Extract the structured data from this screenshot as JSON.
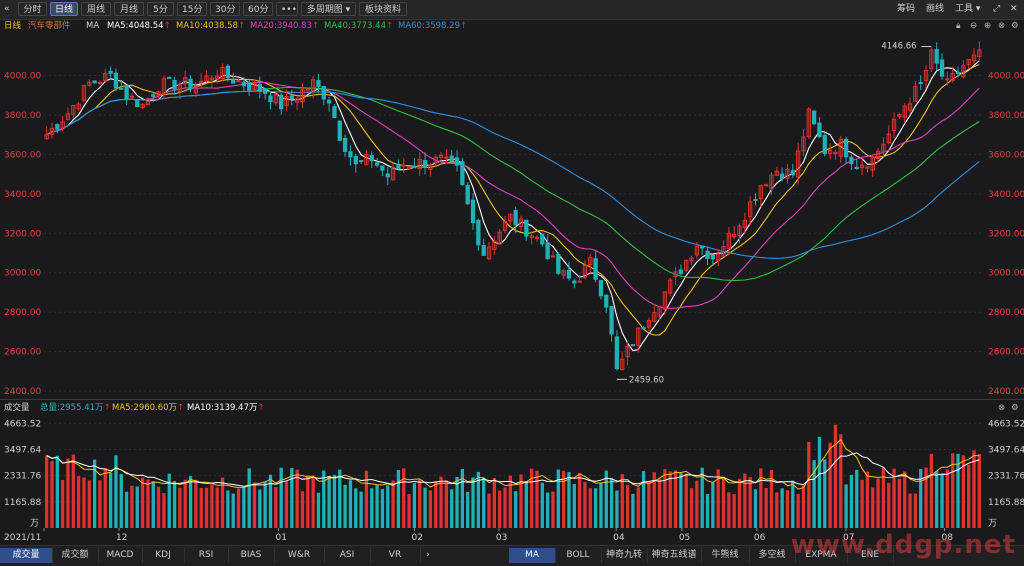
{
  "toolbar": {
    "back_glyph": "«",
    "periods": [
      "分时",
      "日线",
      "周线",
      "月线",
      "5分",
      "15分",
      "30分",
      "60分",
      "•••"
    ],
    "active_period": "日线",
    "multi_period": "多周期图",
    "sector_info": "板块资料",
    "right": [
      "筹码",
      "画线",
      "工具"
    ],
    "icons": [
      "dropdown-icon",
      "expand-icon",
      "close-icon"
    ]
  },
  "legend": {
    "period": "日线",
    "name": "汽车零部件",
    "ma": "MA",
    "items": [
      {
        "label": "MA5:4048.54",
        "color": "#ffffff"
      },
      {
        "label": "MA10:4038.58",
        "color": "#f0c020"
      },
      {
        "label": "MA20:3940.83",
        "color": "#e040c0"
      },
      {
        "label": "MA40:3773.44",
        "color": "#30c040"
      },
      {
        "label": "MA60:3598.29",
        "color": "#3090e0"
      }
    ],
    "arrow": "↑"
  },
  "volume_legend": {
    "title": "成交量",
    "items": [
      {
        "label": "总量:2955.41万",
        "color": "#30b0c0"
      },
      {
        "label": "MA5:2960.60万",
        "color": "#f0c020"
      },
      {
        "label": "MA10:3139.47万",
        "color": "#ffffff"
      }
    ],
    "arrow": "↑"
  },
  "colors": {
    "up": "#e03030",
    "down": "#20b0b8",
    "grid": "#2e2e34",
    "axis_text": "#cfcfcf",
    "price_text_right": "#e04040"
  },
  "chart_data": [
    {
      "type": "candlestick",
      "ylim": [
        2380,
        4180
      ],
      "y_ticks": [
        "4000.00",
        "3800.00",
        "3600.00",
        "3400.00",
        "3200.00",
        "3000.00",
        "2800.00",
        "2600.00",
        "2400.00"
      ],
      "y_tick_values": [
        4000,
        3800,
        3600,
        3400,
        3200,
        3000,
        2800,
        2600,
        2400
      ],
      "x_labels": [
        "2021/11",
        "12",
        "01",
        "02",
        "03",
        "04",
        "05",
        "06",
        "07",
        "08"
      ],
      "annotations": [
        {
          "text": "4146.66",
          "value": 4146.66,
          "index": 166
        },
        {
          "text": "2459.60",
          "value": 2459.6,
          "index": 107
        }
      ],
      "candle_count": 176,
      "anchors": [
        [
          0,
          3700
        ],
        [
          4,
          3810
        ],
        [
          8,
          3960
        ],
        [
          12,
          4000
        ],
        [
          15,
          3900
        ],
        [
          18,
          3850
        ],
        [
          21,
          3950
        ],
        [
          25,
          3960
        ],
        [
          28,
          3950
        ],
        [
          32,
          4020
        ],
        [
          35,
          3980
        ],
        [
          38,
          3950
        ],
        [
          41,
          3920
        ],
        [
          44,
          3850
        ],
        [
          47,
          3900
        ],
        [
          50,
          3960
        ],
        [
          53,
          3880
        ],
        [
          55,
          3700
        ],
        [
          58,
          3540
        ],
        [
          61,
          3580
        ],
        [
          64,
          3490
        ],
        [
          67,
          3550
        ],
        [
          71,
          3560
        ],
        [
          74,
          3570
        ],
        [
          77,
          3520
        ],
        [
          80,
          3250
        ],
        [
          82,
          3100
        ],
        [
          84,
          3180
        ],
        [
          87,
          3280
        ],
        [
          90,
          3220
        ],
        [
          93,
          3150
        ],
        [
          96,
          3000
        ],
        [
          99,
          2950
        ],
        [
          102,
          3050
        ],
        [
          105,
          2850
        ],
        [
          107,
          2500
        ],
        [
          110,
          2650
        ],
        [
          113,
          2790
        ],
        [
          116,
          2900
        ],
        [
          119,
          3020
        ],
        [
          122,
          3150
        ],
        [
          125,
          3080
        ],
        [
          128,
          3180
        ],
        [
          131,
          3300
        ],
        [
          134,
          3450
        ],
        [
          137,
          3520
        ],
        [
          140,
          3500
        ],
        [
          143,
          3800
        ],
        [
          146,
          3620
        ],
        [
          149,
          3650
        ],
        [
          152,
          3550
        ],
        [
          155,
          3580
        ],
        [
          158,
          3700
        ],
        [
          161,
          3850
        ],
        [
          164,
          3950
        ],
        [
          166,
          4100
        ],
        [
          169,
          3950
        ],
        [
          172,
          4050
        ],
        [
          175,
          4100
        ]
      ],
      "series_colors": [
        "#ffffff",
        "#f0c020",
        "#e040c0",
        "#30c040",
        "#3090e0"
      ],
      "series_periods": [
        5,
        10,
        20,
        40,
        60
      ]
    },
    {
      "type": "bar",
      "title": "成交量",
      "ylim": [
        0,
        4900
      ],
      "y_ticks": [
        "4663.52",
        "3497.64",
        "2331.76",
        "1165.88"
      ],
      "y_tick_values": [
        4663.52,
        3497.64,
        2331.76,
        1165.88
      ],
      "unit": "万"
    }
  ],
  "bottom_tabs_left": [
    "成交量",
    "成交额",
    "MACD",
    "KDJ",
    "RSI",
    "BIAS",
    "W&R",
    "ASI",
    "VR"
  ],
  "bottom_tabs_right": [
    "MA",
    "BOLL",
    "神奇九转",
    "神奇五线谱",
    "牛熊线",
    "多空线",
    "EXPMA",
    "ENE"
  ],
  "more_glyph": "›",
  "watermark": "www.ddgp.net"
}
